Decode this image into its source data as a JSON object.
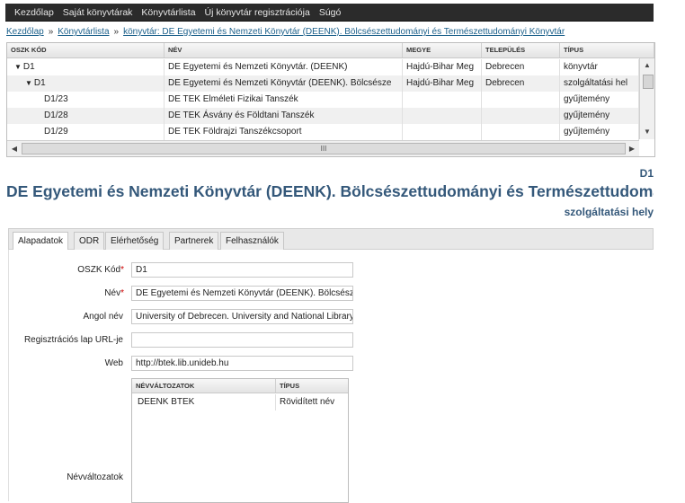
{
  "topnav": {
    "items": [
      "Kezdőlap",
      "Saját könyvtárak",
      "Könyvtárlista",
      "Új könyvtár regisztrációja",
      "Súgó"
    ]
  },
  "breadcrumb": {
    "items": [
      "Kezdőlap",
      "Könyvtárlista",
      "könyvtár: DE Egyetemi és Nemzeti Könyvtár (DEENK). Bölcsészettudományi és Természettudományi Könyvtár"
    ],
    "separator": "»"
  },
  "grid": {
    "columns": [
      "OSZK KÓD",
      "NÉV",
      "MEGYE",
      "TELEPÜLÉS",
      "TÍPUS"
    ],
    "rows": [
      {
        "tri": "▼",
        "code": "D1",
        "name": "DE Egyetemi és Nemzeti Könyvtár. (DEENK)",
        "county": "Hajdú-Bihar Meg",
        "city": "Debrecen",
        "type": "könyvtár"
      },
      {
        "tri": "▼",
        "code": "D1",
        "name": "DE Egyetemi és Nemzeti Könyvtár (DEENK). Bölcsésze",
        "county": "Hajdú-Bihar Meg",
        "city": "Debrecen",
        "type": "szolgáltatási hel"
      },
      {
        "tri": "",
        "code": "D1/23",
        "name": "DE TEK Elméleti Fizikai Tanszék",
        "county": "",
        "city": "",
        "type": "gyűjtemény"
      },
      {
        "tri": "",
        "code": "D1/28",
        "name": "DE TEK Ásvány és Földtani Tanszék",
        "county": "",
        "city": "",
        "type": "gyűjtemény"
      },
      {
        "tri": "",
        "code": "D1/29",
        "name": "DE TEK Földrajzi Tanszékcsoport",
        "county": "",
        "city": "",
        "type": "gyűjtemény"
      }
    ],
    "hscroll_grip": "III"
  },
  "detail": {
    "code": "D1",
    "title": "DE Egyetemi és Nemzeti Könyvtár (DEENK). Bölcsészettudományi és Természettudományi Könyvtár",
    "type": "szolgáltatási hely"
  },
  "tabs": [
    "Alapadatok",
    "ODR",
    "Elérhetőség",
    "Partnerek",
    "Felhasználók"
  ],
  "form": {
    "oszk_label": "OSZK Kód",
    "oszk_value": "D1",
    "nev_label": "Név",
    "nev_value": "DE Egyetemi és Nemzeti Könyvtár (DEENK). Bölcsészettudományi",
    "angol_label": "Angol név",
    "angol_value": "University of Debrecen. University and National Library",
    "url_label": "Regisztrációs lap URL-je",
    "url_value": "",
    "web_label": "Web",
    "web_value": "http://btek.lib.unideb.hu",
    "valt_label": "Névváltozatok",
    "required_mark": "*"
  },
  "variants": {
    "columns": [
      "NÉVVÁLTOZATOK",
      "TÍPUS"
    ],
    "rows": [
      {
        "name": "DEENK BTEK",
        "type": "Rövidített név"
      }
    ]
  }
}
